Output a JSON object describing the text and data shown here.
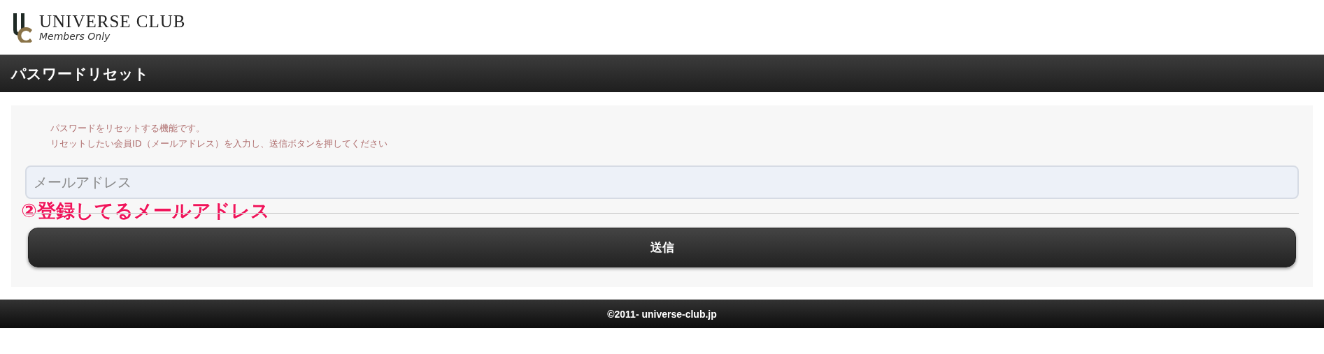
{
  "logo": {
    "title": "UNIVERSE CLUB",
    "subtitle": "Members Only"
  },
  "page_title": "パスワードリセット",
  "instructions": [
    "パスワードをリセットする機能です。",
    "リセットしたい会員ID（メールアドレス）を入力し、送信ボタンを押してください"
  ],
  "email_field": {
    "placeholder": "メールアドレス"
  },
  "annotation": "②登録してるメールアドレス",
  "submit_button": "送信",
  "footer": "©2011- universe-club.jp"
}
